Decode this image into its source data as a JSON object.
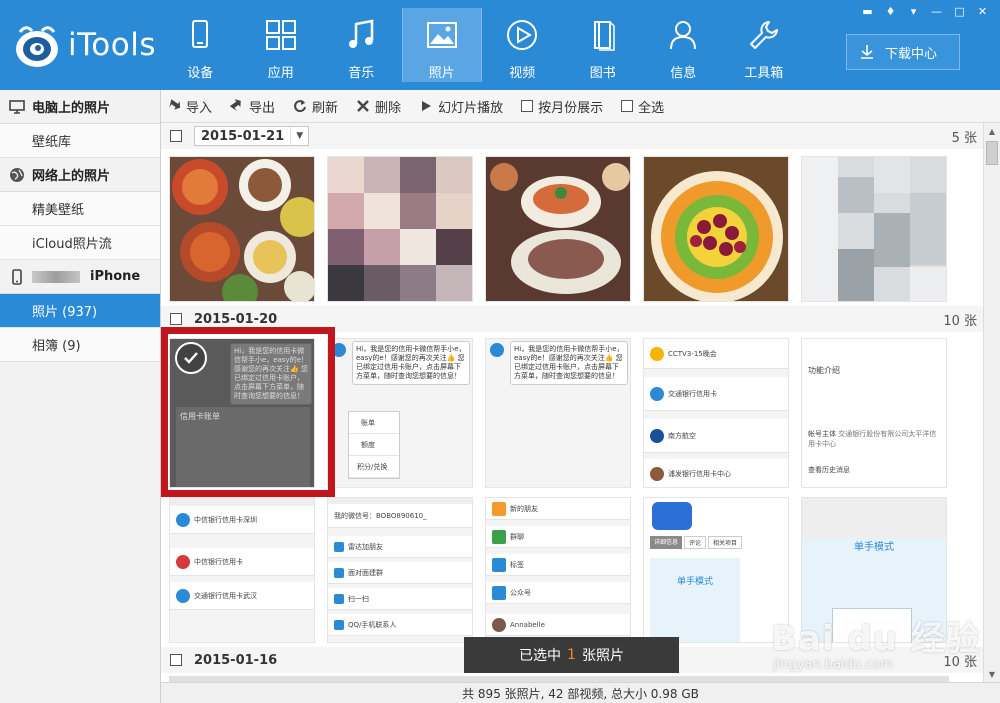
{
  "app": {
    "name": "iTools",
    "colors": {
      "header": "#2b8ad6",
      "accent": "#ff8a1c",
      "selection": "#c0161c"
    }
  },
  "nav": {
    "items": [
      {
        "label": "设备",
        "icon": "phone-icon"
      },
      {
        "label": "应用",
        "icon": "apps-grid-icon"
      },
      {
        "label": "音乐",
        "icon": "music-note-icon"
      },
      {
        "label": "照片",
        "icon": "photo-icon",
        "active": true
      },
      {
        "label": "视频",
        "icon": "play-circle-icon"
      },
      {
        "label": "图书",
        "icon": "book-icon"
      },
      {
        "label": "信息",
        "icon": "person-icon"
      },
      {
        "label": "工具箱",
        "icon": "wrench-icon"
      }
    ],
    "download_label": "下载中心"
  },
  "sidebar": {
    "sections": [
      {
        "title": "电脑上的照片",
        "icon": "monitor-icon",
        "items": [
          {
            "label": "壁纸库"
          }
        ]
      },
      {
        "title": "网络上的照片",
        "icon": "globe-icon",
        "items": [
          {
            "label": "精美壁纸"
          },
          {
            "label": "iCloud照片流"
          }
        ]
      },
      {
        "title": "iPhone",
        "icon": "phone-icon",
        "items": [
          {
            "label": "照片 (937)",
            "active": true
          },
          {
            "label": "相簿 (9)"
          }
        ]
      }
    ]
  },
  "toolbar": {
    "import": "导入",
    "export": "导出",
    "refresh": "刷新",
    "delete": "删除",
    "slideshow": "幻灯片播放",
    "by_month": "按月份展示",
    "select_all": "全选"
  },
  "groups": [
    {
      "date": "2015-01-21",
      "count": "5 张"
    },
    {
      "date": "2015-01-20",
      "count": "10 张"
    },
    {
      "date": "2015-01-16",
      "count": "10 张"
    }
  ],
  "screens": {
    "chat_bubble": "Hi，我是您的信用卡微信帮手小e，easy的e！感谢您的再次关注👍 您已绑定过信用卡账户，点击屏幕下方菜单，随时查询您想要的信息！",
    "bill_title": "信用卡账单",
    "menu_items": [
      "账单",
      "额度",
      "积分/兑换"
    ],
    "list_items": [
      "CCTV3-15晚会",
      "交通银行信用卡",
      "南方航空",
      "浦发银行信用卡中心"
    ],
    "func_intro": "功能介绍",
    "account_subject": "帐号主体",
    "account_value": "交通银行股份有限公司太平洋信用卡中心",
    "history": "查看历史消息",
    "row3_col1": [
      "中信银行信用卡深圳",
      "中信银行信用卡",
      "交通银行信用卡武汉"
    ],
    "wechat_id": "我的微信号：BOBO890610_",
    "row3_col2": [
      "雷达加朋友",
      "面对面建群",
      "扫一扫",
      "QQ/手机联系人"
    ],
    "row3_col3": [
      "新的朋友",
      "群聊",
      "标签",
      "公众号",
      "Annabelle"
    ],
    "app_store": [
      "详细信息",
      "评论",
      "相关项目"
    ],
    "single_mode": "单手模式"
  },
  "toast": {
    "prefix": "已选中",
    "count": "1",
    "suffix": "张照片"
  },
  "watermark": {
    "main": "Bai du 经验",
    "sub": "jingyan.baidu.com"
  },
  "status": "共 895 张照片, 42 部视频, 总大小 0.98 GB"
}
